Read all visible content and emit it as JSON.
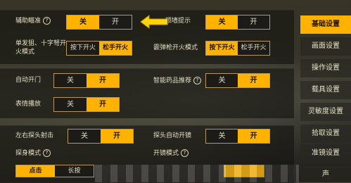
{
  "settings": {
    "aim_assist": {
      "label": "辅助瞄准",
      "off": "关",
      "on": "开"
    },
    "wall_hint": {
      "label": "顶墙提示",
      "off": "关",
      "on": "开"
    },
    "single_cross_fire": {
      "label": "单发狙、十字弩开火模式",
      "opt1": "按下开火",
      "opt2": "松手开火"
    },
    "shotgun_fire": {
      "label": "霰弹枪开火模式",
      "opt1": "按下开火",
      "opt2": "松手开火"
    },
    "auto_door": {
      "label": "自动开门",
      "off": "关",
      "on": "开"
    },
    "smart_meds": {
      "label": "智能药品推荐",
      "off": "关",
      "on": "开"
    },
    "emote": {
      "label": "表情播放",
      "off": "关",
      "on": "开"
    },
    "peek_shoot": {
      "label": "左右探头射击",
      "off": "关",
      "on": "开"
    },
    "peek_auto_scope": {
      "label": "探头自动开镜",
      "off": "关",
      "on": "开"
    },
    "peek_mode": {
      "label": "探身模式",
      "opt1": "点击",
      "opt2": "长按"
    },
    "scope_mode": {
      "label": "开镜模式"
    }
  },
  "tabs": [
    {
      "label": "基础设置",
      "active": true
    },
    {
      "label": "画面设置"
    },
    {
      "label": "操作设置"
    },
    {
      "label": "载具设置"
    },
    {
      "label": "灵敏度设置"
    },
    {
      "label": "拾取设置"
    },
    {
      "label": "准镜设置"
    },
    {
      "label": "声"
    }
  ],
  "help_glyph": "?",
  "colors": {
    "accent": "#ffb300",
    "arrow": "#ffd400"
  }
}
